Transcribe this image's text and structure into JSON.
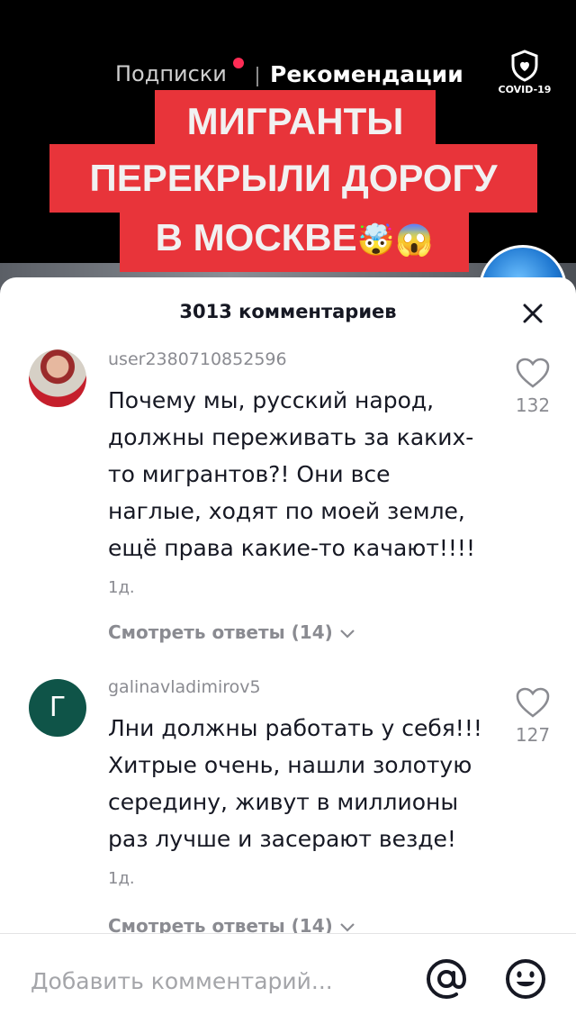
{
  "top_tabs": {
    "following": "Подписки",
    "recommendations": "Рекомендации",
    "covid_label": "COVID-19"
  },
  "video_banner": {
    "line1": "МИГРАНТЫ",
    "line2": "ПЕРЕКРЫЛИ ДОРОГУ",
    "line3": "В МОСКВЕ",
    "emoji": "🤯😱"
  },
  "comments_sheet": {
    "title": "3013 комментариев",
    "comments": [
      {
        "username": "user2380710852596",
        "text": "Почему мы, русский народ, должны переживать за каких-то мигрантов?! Они все наглые, ходят по моей земле, ещё права какие-то качают!!!!",
        "time": "1д.",
        "likes": "132",
        "replies": "Смотреть ответы (14)",
        "avatar_letter": ""
      },
      {
        "username": "galinavladimirov5",
        "text": "Лни должны работать у себя!!! Хитрые очень, нашли золотую середину, живут в миллионы раз лучше и засерают везде!",
        "time": "1д.",
        "likes": "127",
        "replies": "Смотреть ответы (14)",
        "avatar_letter": "Г"
      }
    ]
  },
  "footer": {
    "placeholder": "Добавить комментарий..."
  },
  "colors": {
    "accent": "#fe2c55",
    "banner": "#e8343a",
    "secondary_text": "#8a8b91"
  }
}
